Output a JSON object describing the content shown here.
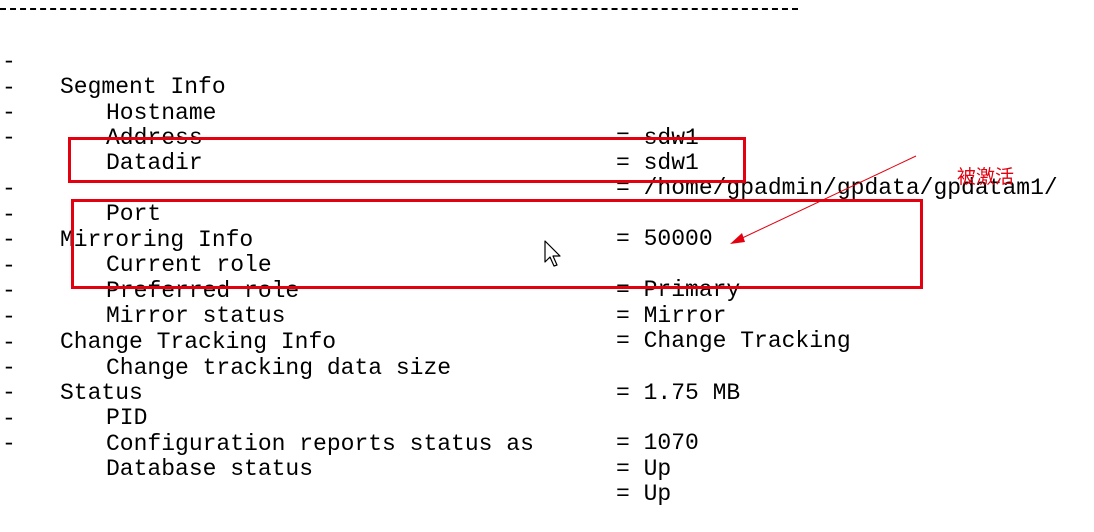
{
  "rule_text": "",
  "lines": [
    {
      "indent": 0,
      "label": "Segment Info",
      "value": ""
    },
    {
      "indent": 1,
      "label": "Hostname",
      "value": "= sdw1"
    },
    {
      "indent": 1,
      "label": "Address",
      "value": "= sdw1"
    },
    {
      "indent": 1,
      "label": "Datadir",
      "value": "= /home/gpadmin/gpdata/gpdatam1/"
    },
    {
      "indent": 1,
      "label": "Port",
      "value": "= 50000"
    },
    {
      "indent": 0,
      "label": "Mirroring Info",
      "value": ""
    },
    {
      "indent": 1,
      "label": "Current role",
      "value": "= Primary"
    },
    {
      "indent": 1,
      "label": "Preferred role",
      "value": "= Mirror"
    },
    {
      "indent": 1,
      "label": "Mirror status",
      "value": "= Change Tracking"
    },
    {
      "indent": 0,
      "label": "Change Tracking Info",
      "value": ""
    },
    {
      "indent": 1,
      "label": "Change tracking data size",
      "value": "= 1.75 MB"
    },
    {
      "indent": 0,
      "label": "Status",
      "value": ""
    },
    {
      "indent": 1,
      "label": "PID",
      "value": "= 1070"
    },
    {
      "indent": 1,
      "label": "Configuration reports status as",
      "value": "= Up"
    },
    {
      "indent": 1,
      "label": "Database status",
      "value": "= Up"
    }
  ],
  "dash": "-",
  "annotation": {
    "text": "被激活",
    "color": "#e3000f"
  },
  "colors": {
    "text": "#000000",
    "highlight": "#e3000f",
    "background": "#ffffff"
  }
}
